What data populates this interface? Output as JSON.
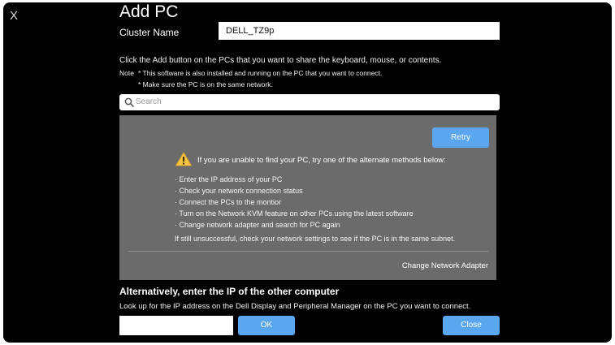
{
  "window": {
    "close_glyph": "X",
    "title": "Add PC"
  },
  "cluster": {
    "label": "Cluster Name",
    "value": "DELL_TZ9p"
  },
  "instructions": {
    "main": "Click the Add button on the PCs that you want to share the keyboard, mouse, or contents.",
    "note_label": "Note",
    "note_1": "* This software is also installed and running on the PC that you want to connect.",
    "note_2": "* Make sure the PC is on the same network."
  },
  "search": {
    "placeholder": "Search",
    "icon": "magnifier-icon"
  },
  "panel": {
    "retry_label": "Retry",
    "warning_icon": "warning-triangle-icon",
    "warning_text": "If you are unable to find your PC, try one of the alternate methods below:",
    "tips": [
      "· Enter the IP address of your PC",
      "· Check your network connection status",
      "· Connect the PCs to the montior",
      "· Turn on the Network KVM feature on other PCs using the latest software",
      "· Change network adapter and search for PC again"
    ],
    "still_text": "If still unsuccessful, check your network settings to see if the PC is in the same subnet.",
    "change_adapter_label": "Change Network Adapter"
  },
  "alternative": {
    "heading": "Alternatively, enter the IP of the other computer",
    "description": "Look up for the IP address on the Dell Display and Peripheral Manager on the PC you want to connect.",
    "ip_value": "",
    "ok_label": "OK",
    "close_label": "Close"
  },
  "colors": {
    "background": "#000000",
    "panel": "#6b6b6b",
    "accent": "#5aa6ef",
    "warning": "#f5c242"
  }
}
